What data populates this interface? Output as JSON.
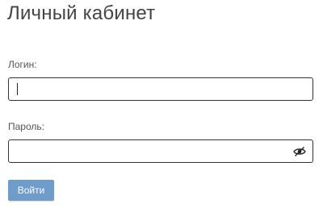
{
  "page": {
    "title": "Личный кабинет"
  },
  "form": {
    "login_label": "Логин:",
    "login_value": "",
    "password_label": "Пароль:",
    "password_value": "",
    "submit_label": "Войти"
  },
  "icons": {
    "password_toggle": "eye-slash-icon"
  },
  "colors": {
    "button_bg": "#6e9ccb",
    "border": "#333333"
  }
}
